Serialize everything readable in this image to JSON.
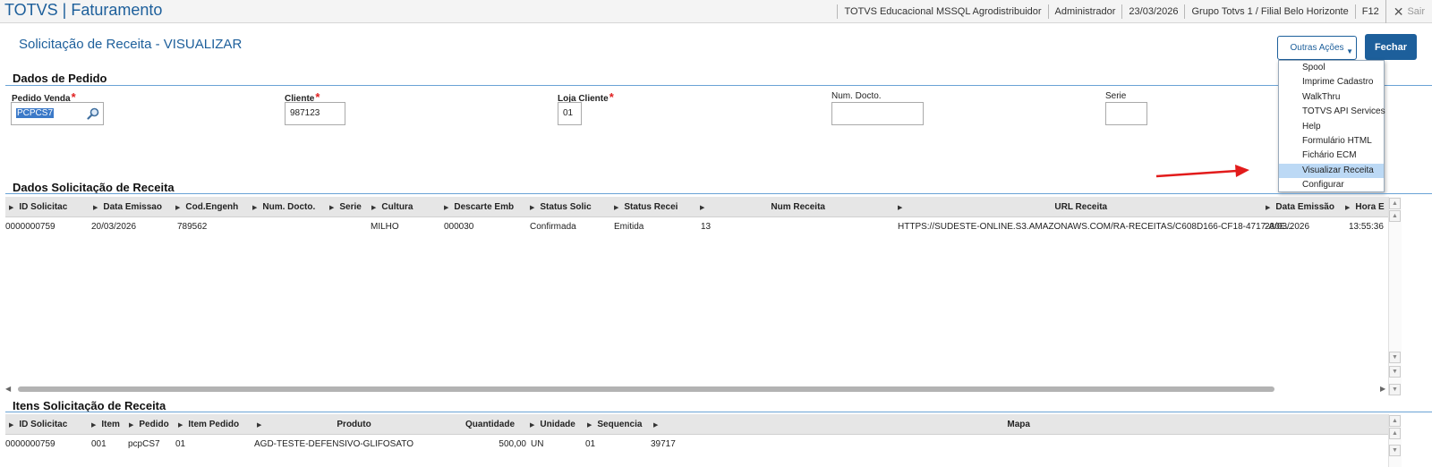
{
  "app": {
    "title": "TOTVS | Faturamento",
    "topbar": [
      "TOTVS Educacional MSSQL Agrodistribuidor",
      "Administrador",
      "23/03/2026",
      "Grupo Totvs 1 / Filial Belo Horizonte",
      "F12"
    ],
    "exit_label": "Sair"
  },
  "page": {
    "title": "Solicitação de Receita - VISUALIZAR",
    "outras_acoes_label": "Outras Ações",
    "fechar_label": "Fechar"
  },
  "menu": {
    "items": [
      "Spool",
      "Imprime Cadastro",
      "WalkThru",
      "TOTVS API Services",
      "Help",
      "Formulário HTML",
      "Fichário ECM",
      "Visualizar Receita",
      "Configurar"
    ],
    "active": "Visualizar Receita"
  },
  "pedido": {
    "section_title": "Dados de Pedido",
    "fields": {
      "pedido_venda": {
        "label": "Pedido Venda",
        "value": "PCPCS7"
      },
      "cliente": {
        "label": "Cliente",
        "value": "987123"
      },
      "loja_cliente": {
        "label": "Loja Cliente",
        "value": "01"
      },
      "num_docto": {
        "label": "Num. Docto.",
        "value": ""
      },
      "serie": {
        "label": "Serie",
        "value": ""
      }
    }
  },
  "solicitacao": {
    "section_title": "Dados Solicitação de Receita",
    "columns": [
      "ID Solicitac",
      "Data Emissao",
      "Cod.Engenh",
      "Num. Docto.",
      "Serie",
      "Cultura",
      "Descarte Emb",
      "Status Solic",
      "Status Recei",
      "Num Receita",
      "URL Receita",
      "Data Emissão",
      "Hora E"
    ],
    "rows": [
      [
        "0000000759",
        "20/03/2026",
        "789562",
        "",
        "",
        "MILHO",
        "000030",
        "Confirmada",
        "Emitida",
        "13",
        "HTTPS://SUDESTE-ONLINE.S3.AMAZONAWS.COM/RA-RECEITAS/C608D166-CF18-4717-A0E...",
        "23/03/2026",
        "13:55:36"
      ]
    ]
  },
  "itens": {
    "section_title": "Itens Solicitação de Receita",
    "columns": [
      "ID Solicitac",
      "Item",
      "Pedido",
      "Item Pedido",
      "Produto",
      "Quantidade",
      "Unidade",
      "Sequencia",
      "Mapa"
    ],
    "rows": [
      [
        "0000000759",
        "001",
        "pcpCS7",
        "01",
        "AGD-TESTE-DEFENSIVO-GLIFOSATO",
        "500,00",
        "UN",
        "01",
        "39717"
      ]
    ]
  },
  "colors": {
    "accent": "#1d5f9b",
    "required": "#e02020",
    "menu_active": "#bcd9f5",
    "annotation": "#e21b1b"
  }
}
